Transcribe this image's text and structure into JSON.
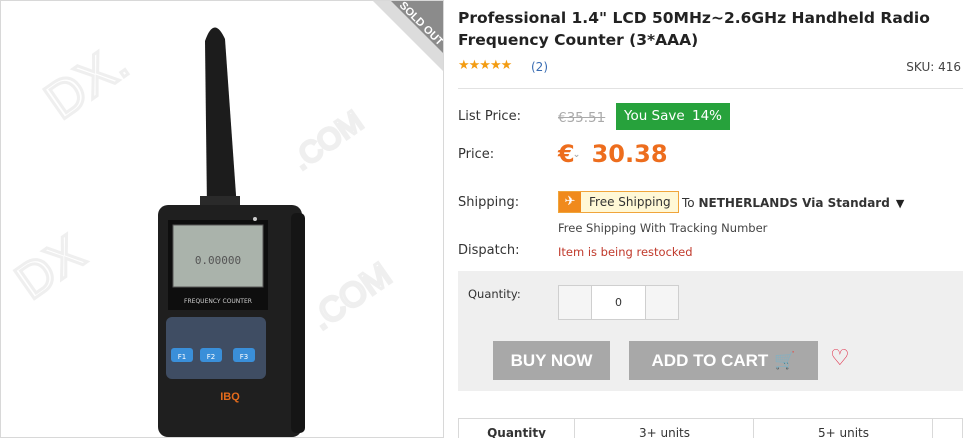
{
  "product": {
    "title": "Professional 1.4\" LCD 50MHz~2.6GHz Handheld Radio Frequency Counter (3*AAA)",
    "image_label": "FREQUENCY COUNTER",
    "image_brand": "IBQ",
    "lcd_reading": "0.00000",
    "key_labels": [
      "F1",
      "F2",
      "F3"
    ],
    "ribbon": "SOLD OUT"
  },
  "rating": {
    "stars": "★★★★★",
    "reviews": "(2)"
  },
  "sku": "SKU: 416",
  "pricing": {
    "list_label": "List Price:",
    "list_price": "€35.51",
    "save_label": "You Save",
    "save_pct": "14%",
    "price_label": "Price:",
    "currency": "€",
    "currency_caret": "⌄",
    "price": "30.38"
  },
  "shipping": {
    "label": "Shipping:",
    "badge": "Free Shipping",
    "to": "To",
    "destination": "NETHERLANDS Via Standard",
    "note": "Free Shipping With Tracking Number"
  },
  "dispatch": {
    "label": "Dispatch:",
    "status": "Item is being restocked"
  },
  "cart": {
    "qty_label": "Quantity:",
    "qty_value": "0",
    "buy_now": "BUY NOW",
    "add_to_cart": "ADD TO CART"
  },
  "tiers": {
    "header": "Quantity",
    "cols": [
      "3+ units",
      "5+ units",
      ""
    ]
  },
  "colors": {
    "accent_price": "#ed6d1d",
    "save_green": "#27a23c",
    "dispatch_red": "#c0392b",
    "button_gray": "#a8a8a8",
    "wishlist_red": "#e0334d"
  },
  "icons": [
    "plane-icon",
    "cart-icon",
    "heart-icon",
    "caret-down-icon",
    "star-icon"
  ]
}
